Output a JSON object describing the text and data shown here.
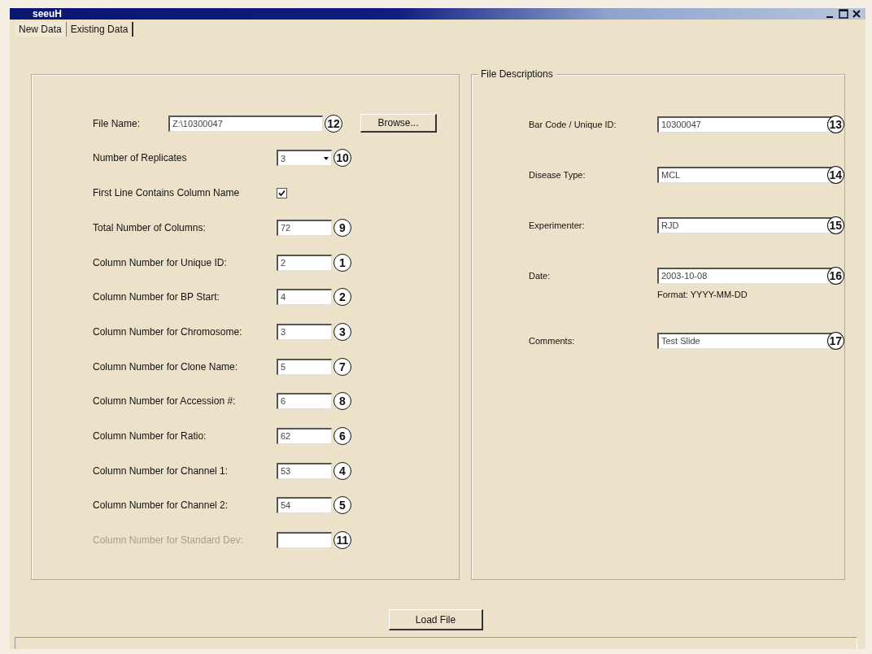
{
  "window": {
    "title": "seeuH"
  },
  "tabs": [
    {
      "label": "New Data",
      "selected": true
    },
    {
      "label": "Existing Data",
      "selected": false
    }
  ],
  "left_panel": {
    "fields": [
      {
        "kind": "file",
        "label": "File Name:",
        "value": "Z:\\10300047",
        "callout": "12",
        "button": "Browse..."
      },
      {
        "kind": "select",
        "label": "Number of Replicates",
        "value": "3",
        "callout": "10"
      },
      {
        "kind": "checkbox",
        "label": "First Line Contains Column Name",
        "checked": true
      },
      {
        "kind": "text",
        "label": "Total Number of Columns:",
        "value": "72",
        "callout": "9"
      },
      {
        "kind": "text",
        "label": "Column Number for Unique ID:",
        "value": "2",
        "callout": "1"
      },
      {
        "kind": "text",
        "label": "Column Number for BP Start:",
        "value": "4",
        "callout": "2"
      },
      {
        "kind": "text",
        "label": "Column Number for Chromosome:",
        "value": "3",
        "callout": "3"
      },
      {
        "kind": "text",
        "label": "Column Number for Clone Name:",
        "value": "5",
        "callout": "7"
      },
      {
        "kind": "text",
        "label": "Column Number for Accession #:",
        "value": "6",
        "callout": "8"
      },
      {
        "kind": "text",
        "label": "Column Number for Ratio:",
        "value": "62",
        "callout": "6"
      },
      {
        "kind": "text",
        "label": "Column Number for Channel 1:",
        "value": "53",
        "callout": "4"
      },
      {
        "kind": "text",
        "label": "Column Number for Channel 2:",
        "value": "54",
        "callout": "5"
      },
      {
        "kind": "text",
        "label": "Column Number for Standard Dev:",
        "callout": "11",
        "disabled": true
      }
    ]
  },
  "right_panel": {
    "legend": "File Descriptions",
    "fields": [
      {
        "label": "Bar Code / Unique ID:",
        "value": "10300047",
        "callout": "13"
      },
      {
        "label": "Disease Type:",
        "value": "MCL",
        "callout": "14"
      },
      {
        "label": "Experimenter:",
        "value": "RJD",
        "callout": "15"
      },
      {
        "label": "Date:",
        "value": "2003-10-08",
        "callout": "16",
        "hint": "Format: YYYY-MM-DD"
      },
      {
        "label": "Comments:",
        "value": "Test Slide",
        "callout": "17"
      }
    ]
  },
  "load_button": "Load File"
}
